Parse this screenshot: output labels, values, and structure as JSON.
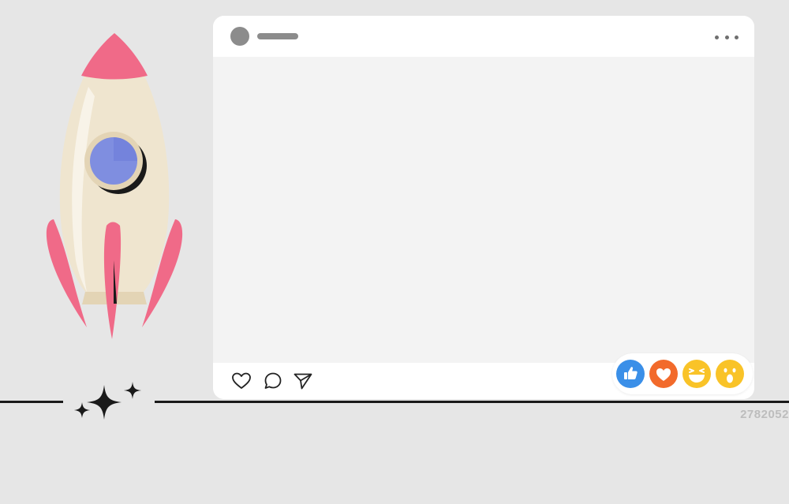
{
  "watermark": {
    "text": "2782052"
  },
  "post": {
    "header": {
      "avatar_icon": "avatar-placeholder",
      "username_placeholder": "username-bar",
      "more_icon": "more-horizontal-icon"
    },
    "actions": [
      {
        "name": "like",
        "icon": "heart-outline-icon"
      },
      {
        "name": "comment",
        "icon": "speech-bubble-icon"
      },
      {
        "name": "share",
        "icon": "paper-plane-icon"
      }
    ],
    "reactions": [
      {
        "name": "like",
        "icon": "thumbs-up-icon",
        "color": "#3a8fe8"
      },
      {
        "name": "love",
        "icon": "heart-icon",
        "color": "#f26a2b"
      },
      {
        "name": "haha",
        "icon": "laughing-face-icon",
        "color": "#f9c328"
      },
      {
        "name": "wow",
        "icon": "surprised-face-icon",
        "color": "#f9c328"
      }
    ]
  },
  "illustration": {
    "rocket_colors": {
      "body": "#efe5cf",
      "nose_and_fins": "#f06a88",
      "window": "#7f8ee0",
      "window_rim": "#e3d4b5"
    },
    "sparkles_icon": "sparkles-icon",
    "baseline_color": "#1a1a1a"
  },
  "colors": {
    "background": "#e6e6e6",
    "card": "#ffffff",
    "media_placeholder": "#f3f3f3",
    "placeholder_gray": "#8c8c8c"
  }
}
